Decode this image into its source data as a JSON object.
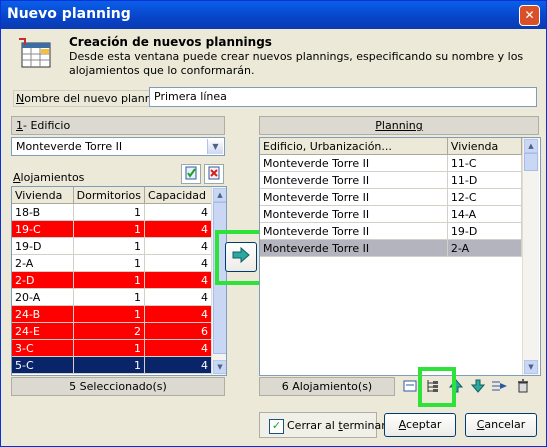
{
  "window": {
    "title": "Nuevo planning",
    "close_glyph": "✕"
  },
  "header": {
    "title": "Creación de nuevos plannings",
    "description": "Desde esta ventana puede crear nuevos plannings, especificando su nombre y los alojamientos que lo conformarán."
  },
  "name_field": {
    "label_first": "N",
    "label_rest": "ombre del nuevo planning",
    "value": "Primera línea"
  },
  "building": {
    "label_first": "1",
    "label_rest": "- Edificio",
    "selected": "Monteverde Torre II"
  },
  "alojamientos": {
    "label_first": "A",
    "label_rest": "lojamientos",
    "columns": [
      "Vivienda",
      "Dormitorios",
      "Capacidad"
    ],
    "rows": [
      {
        "vivienda": "18-B",
        "dormitorios": "1",
        "capacidad": "4",
        "state": "normal"
      },
      {
        "vivienda": "19-C",
        "dormitorios": "1",
        "capacidad": "4",
        "state": "red"
      },
      {
        "vivienda": "19-D",
        "dormitorios": "1",
        "capacidad": "4",
        "state": "normal"
      },
      {
        "vivienda": "2-A",
        "dormitorios": "1",
        "capacidad": "4",
        "state": "normal"
      },
      {
        "vivienda": "2-D",
        "dormitorios": "1",
        "capacidad": "4",
        "state": "red"
      },
      {
        "vivienda": "20-A",
        "dormitorios": "1",
        "capacidad": "4",
        "state": "normal"
      },
      {
        "vivienda": "24-B",
        "dormitorios": "1",
        "capacidad": "4",
        "state": "red"
      },
      {
        "vivienda": "24-E",
        "dormitorios": "2",
        "capacidad": "6",
        "state": "red"
      },
      {
        "vivienda": "3-C",
        "dormitorios": "1",
        "capacidad": "4",
        "state": "red"
      },
      {
        "vivienda": "5-C",
        "dormitorios": "1",
        "capacidad": "4",
        "state": "selected"
      }
    ],
    "status": "5 Seleccionado(s)"
  },
  "planning": {
    "title": "Planning",
    "columns": [
      "Edificio, Urbanización...",
      "Vivienda"
    ],
    "rows": [
      {
        "edificio": "Monteverde Torre II",
        "vivienda": "11-C",
        "selected": false
      },
      {
        "edificio": "Monteverde Torre II",
        "vivienda": "11-D",
        "selected": false
      },
      {
        "edificio": "Monteverde Torre II",
        "vivienda": "12-C",
        "selected": false
      },
      {
        "edificio": "Monteverde Torre II",
        "vivienda": "14-A",
        "selected": false
      },
      {
        "edificio": "Monteverde Torre II",
        "vivienda": "19-D",
        "selected": false
      },
      {
        "edificio": "Monteverde Torre II",
        "vivienda": "2-A",
        "selected": true
      }
    ],
    "status": "6 Alojamiento(s)"
  },
  "footer": {
    "close_on_finish_first": "Cerrar al ",
    "close_on_finish_u": "t",
    "close_on_finish_rest": "erminar",
    "close_on_finish_checked": true,
    "accept_first": "A",
    "accept_rest": "ceptar",
    "cancel_first": "C",
    "cancel_rest": "ancelar"
  },
  "colors": {
    "row_red": "#FF0000",
    "row_selected": "#0A246A",
    "planning_selected": "#B4B4BF",
    "highlight": "#2EE23A"
  }
}
